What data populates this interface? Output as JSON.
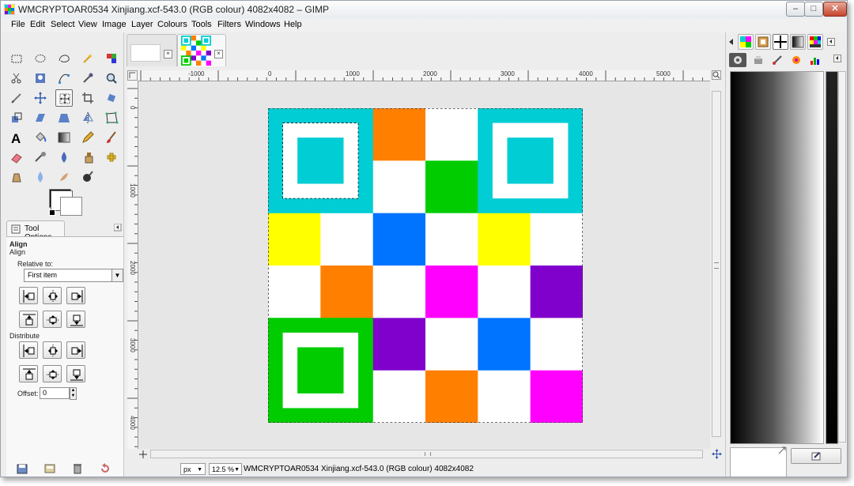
{
  "window": {
    "title": "WMCRYPTOAR0534 Xinjiang.xcf-543.0 (RGB colour) 4082x4082 – GIMP",
    "minimize_label": "–",
    "maximize_label": "□",
    "close_label": "✕"
  },
  "menu": {
    "items": [
      "File",
      "Edit",
      "Select",
      "View",
      "Image",
      "Layer",
      "Colours",
      "Tools",
      "Filters",
      "Windows",
      "Help"
    ]
  },
  "toolbox": {
    "tools": [
      "rect-select",
      "ellipse-select",
      "free-select",
      "fuzzy-select",
      "select-by-color",
      "scissors",
      "foreground-select",
      "paths",
      "color-picker",
      "zoom",
      "measure",
      "move",
      "align",
      "crop",
      "rotate",
      "scale",
      "shear",
      "perspective",
      "flip",
      "cage-transform",
      "text",
      "bucket-fill",
      "blend",
      "pencil",
      "paintbrush",
      "eraser",
      "airbrush",
      "ink",
      "clone",
      "heal",
      "perspective-clone",
      "blur",
      "smudge",
      "dodge-burn"
    ],
    "active_tool": "align"
  },
  "tool_options": {
    "tab_label": "Tool Options",
    "heading": "Align",
    "subheading": "Align",
    "relative_to_label": "Relative to:",
    "relative_to_value": "First item",
    "distribute_label": "Distribute",
    "offset_label": "Offset:",
    "offset_value": "0"
  },
  "image_window": {
    "ruler_h_labels": [
      "-1000",
      "0",
      "1000",
      "2000",
      "3000",
      "4000",
      "5000"
    ],
    "ruler_v_labels": [
      "0",
      "1000",
      "2000",
      "3000",
      "4000"
    ],
    "unit": "px",
    "zoom": "12.5 %",
    "status_text": "WMCRYPTOAR0534 Xinjiang.xcf-543.0 (RGB colour) 4082x4082"
  },
  "image_grid": {
    "rows": [
      [
        "#00cdd4",
        "#00cdd4",
        "#ff8000",
        "#ffffff",
        "#00cdd4",
        "#00cdd4"
      ],
      [
        "#00cdd4",
        "#00cdd4",
        "#ffffff",
        "#00cc00",
        "#00cdd4",
        "#00cdd4"
      ],
      [
        "#ffff00",
        "#ffffff",
        "#0073ff",
        "#ffffff",
        "#ffff00",
        "#ffffff"
      ],
      [
        "#ffffff",
        "#ff8000",
        "#ffffff",
        "#ff00ff",
        "#ffffff",
        "#8000cc"
      ],
      [
        "#00cc00",
        "#00cc00",
        "#8000cc",
        "#ffffff",
        "#0073ff",
        "#ffffff"
      ],
      [
        "#00cc00",
        "#00cc00",
        "#ffffff",
        "#ff8000",
        "#ffffff",
        "#ff00ff"
      ]
    ],
    "finders": [
      {
        "color": "#00cdd4",
        "row": 0,
        "col": 0
      },
      {
        "color": "#00cdd4",
        "row": 0,
        "col": 4
      },
      {
        "color": "#00cc00",
        "row": 4,
        "col": 0
      }
    ]
  },
  "colors": {
    "cyan": "#00cdd4",
    "green": "#00cc00",
    "orange": "#ff8000",
    "yellow": "#ffff00",
    "blue": "#0073ff",
    "magenta": "#ff00ff",
    "purple": "#8000cc"
  }
}
